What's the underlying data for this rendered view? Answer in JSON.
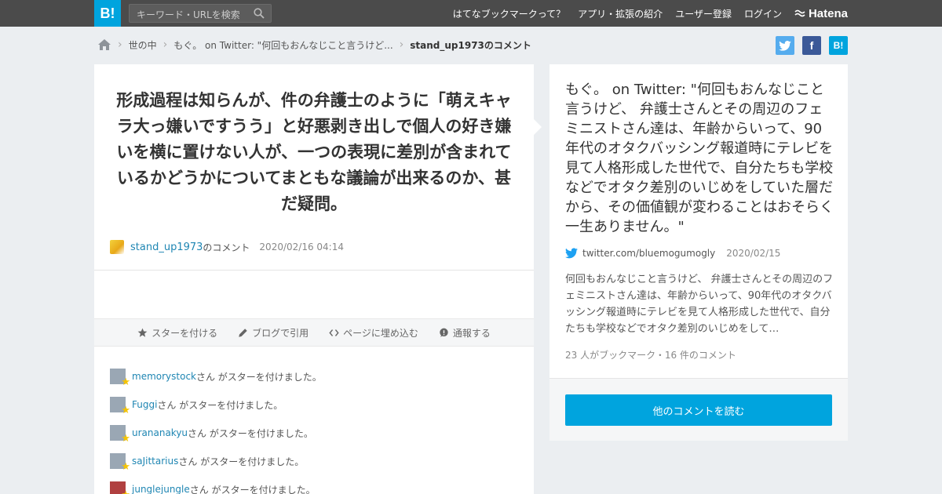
{
  "header": {
    "logo": "B!",
    "search_placeholder": "キーワード・URLを検索",
    "nav": [
      "はてなブックマークって？",
      "アプリ・拡張の紹介",
      "ユーザー登録",
      "ログイン"
    ],
    "brand": "Hatena"
  },
  "breadcrumb": {
    "items": [
      "世の中",
      "もぐ。 on Twitter: \"何回もおんなじこと言うけど..."
    ],
    "current": "stand_up1973のコメント"
  },
  "share": {
    "twitter": "t",
    "facebook": "f",
    "hatena": "B!"
  },
  "comment": {
    "text": "形成過程は知らんが、件の弁護士のように「萌えキャラ大っ嫌いですうう」と好悪剥き出しで個人の好き嫌いを横に置けない人が、一つの表現に差別が含まれているかどうかについてまともな議論が出来るのか、甚だ疑問。",
    "user": "stand_up1973",
    "user_suffix": "のコメント",
    "date": "2020/02/16 04:14"
  },
  "actions": [
    "スターを付ける",
    "ブログで引用",
    "ページに埋め込む",
    "通報する"
  ],
  "stars": [
    {
      "user": "memorystock",
      "text": "さん がスターを付けました。"
    },
    {
      "user": "Fuggi",
      "text": "さん がスターを付けました。"
    },
    {
      "user": "urananakyu",
      "text": "さん がスターを付けました。"
    },
    {
      "user": "saJittarius",
      "text": "さん がスターを付けました。"
    },
    {
      "user": "junglejungle",
      "text": "さん がスターを付けました。"
    }
  ],
  "entry": {
    "title": "もぐ。 on Twitter: \"何回もおんなじこと言うけど、 弁護士さんとその周辺のフェミニストさん達は、年齢からいって、90年代のオタクバッシング報道時にテレビを見て人格形成した世代で、自分たちも学校などでオタク差別のいじめをしていた層だから、その価値観が変わることはおそらく一生ありません。\"",
    "source": "twitter.com/bluemogumogly",
    "date": "2020/02/15",
    "summary": "何回もおんなじこと言うけど、 弁護士さんとその周辺のフェミニストさん達は、年齢からいって、90年代のオタクバッシング報道時にテレビを見て人格形成した世代で、自分たちも学校などでオタク差別のいじめをして…",
    "counts": "23 人がブックマーク・16 件のコメント",
    "more_button": "他のコメントを読む"
  },
  "colors": {
    "accent": "#00a4de",
    "link": "#1f86b3",
    "header_bg": "#4b4b4b",
    "page_bg": "#ebeef1"
  }
}
